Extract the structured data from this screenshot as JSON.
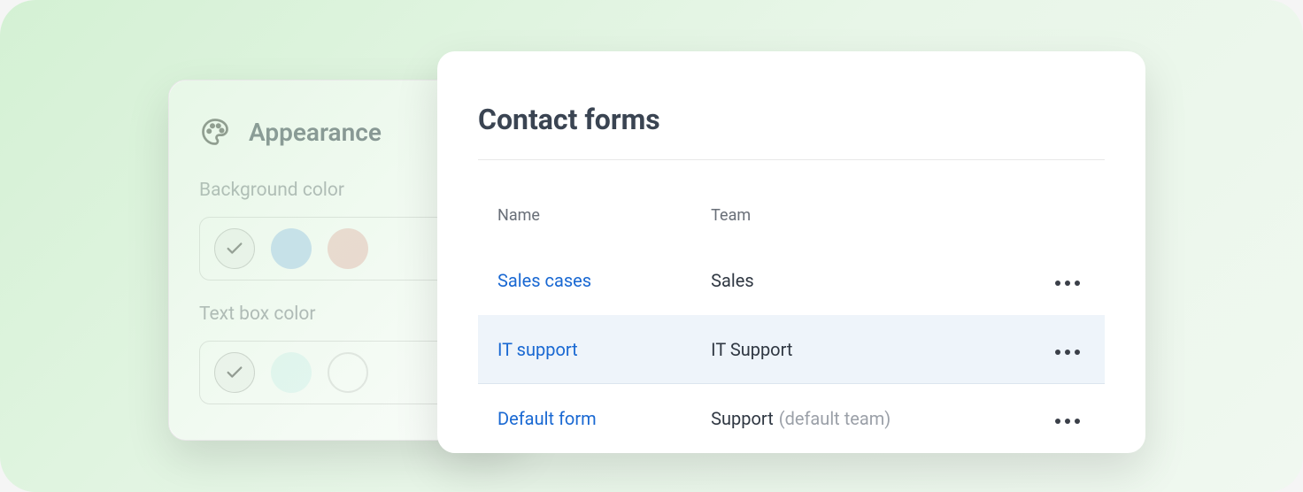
{
  "appearance": {
    "title": "Appearance",
    "bg_label": "Background color",
    "textbox_label": "Text box color"
  },
  "forms": {
    "title": "Contact forms",
    "columns": {
      "name": "Name",
      "team": "Team"
    },
    "rows": [
      {
        "name": "Sales cases",
        "team": "Sales",
        "suffix": ""
      },
      {
        "name": "IT support",
        "team": "IT Support",
        "suffix": ""
      },
      {
        "name": "Default  form",
        "team": "Support",
        "suffix": "(default team)"
      }
    ]
  }
}
